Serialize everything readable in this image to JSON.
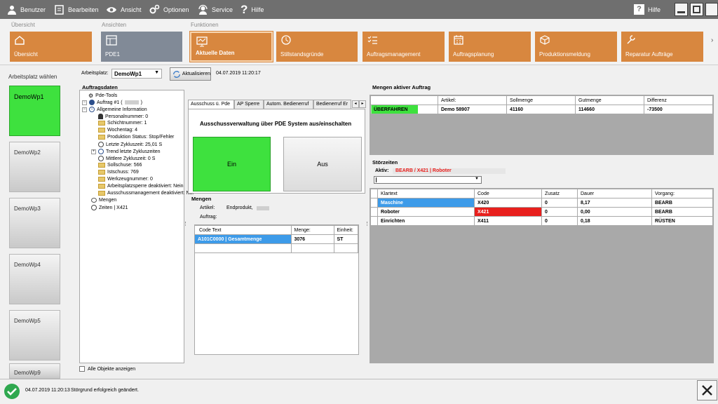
{
  "menu": {
    "items": [
      {
        "label": "Benutzer",
        "icon": "user-icon"
      },
      {
        "label": "Bearbeiten",
        "icon": "edit-icon"
      },
      {
        "label": "Ansicht",
        "icon": "eye-icon"
      },
      {
        "label": "Optionen",
        "icon": "gears-icon"
      },
      {
        "label": "Service",
        "icon": "service-icon"
      },
      {
        "label": "Hilfe",
        "icon": "question-icon"
      }
    ],
    "help_right": "Hilfe"
  },
  "ribbon": {
    "groups": [
      "Übersicht",
      "Ansichten",
      "Funktionen"
    ],
    "tiles": [
      "Übersicht",
      "PDE1",
      "Aktuelle Daten",
      "Stillstandsgründe",
      "Auftragsmanagement",
      "Auftragsplanung",
      "Produktionsmeldung",
      "Reparatur Aufträge"
    ]
  },
  "left": {
    "title": "Arbeitsplatz wählen",
    "workplaces": [
      "DemoWp1",
      "DemoWp2",
      "DemoWp3",
      "DemoWp4",
      "DemoWp5",
      "DemoWp9"
    ]
  },
  "toolbar": {
    "label": "Arbeitsplatz:",
    "value": "DemoWp1",
    "refresh": "Aktualisieren",
    "timestamp": "04.07.2019 11:20:17"
  },
  "auftrag": {
    "title": "Auftragsdaten",
    "tree": [
      "Pde-Tools",
      "Auftrag #1 (",
      "Allgemeine Information",
      "Personalnummer: 0",
      "Schichtnummer: 1",
      "Wochentag: 4",
      "Produktion Status: Stop/Fehler",
      "Letzte Zykluszeit: 25,01 S",
      "Trend letzte Zykluszeiten",
      "Mittlere Zykluszeit: 0 S",
      "Sollschuse: 566",
      "Istschuss: 769",
      "Werkzeugnummer: 0",
      "Arbeitsplatzsperre deaktiviert: Nein",
      "Ausschussmanagement deaktiviert: Nei",
      "Mengen",
      "Zeiten | X421"
    ],
    "show_all": "Alle Objekte anzeigen"
  },
  "tabs": [
    "Ausschuss ü. Pde",
    "AP Sperre",
    "Autom. Bedienerruf",
    "Bedienerruf Er"
  ],
  "ausschuss": {
    "heading": "Ausschussverwaltung über PDE System aus/einschalten",
    "on": "Ein",
    "off": "Aus"
  },
  "mengen": {
    "title": "Mengen",
    "artikel_label": "Artikel:",
    "artikel_value": "Endprodukt,",
    "auftrag_label": "Auftrag:",
    "headers": [
      "Code Text",
      "Menge:",
      "Einheit:"
    ],
    "rows": [
      [
        "A101C0000 | Gesamtmenge",
        "3076",
        "ST"
      ]
    ]
  },
  "aktiv_auftrag": {
    "title": "Mengen aktiver Auftrag",
    "headers": [
      "",
      "Artikel:",
      "Sollmenge",
      "Gutmenge",
      "Differenz"
    ],
    "row": [
      "ÜBERFAHREN",
      "Demo 58907",
      "41160",
      "114660",
      "-73500"
    ]
  },
  "stoerzeiten": {
    "title": "Störzeiten",
    "aktiv_label": "Aktiv:",
    "aktiv_value": "BEARB / X421 | Roboter",
    "headers": [
      "Klartext",
      "Code",
      "Zusatz",
      "Dauer",
      "Vorgang:"
    ],
    "rows": [
      [
        "Maschine",
        "X420",
        "0",
        "8,17",
        "BEARB"
      ],
      [
        "Roboter",
        "X421",
        "0",
        "0,00",
        "BEARB"
      ],
      [
        "Einrichten",
        "X411",
        "0",
        "0,18",
        "RÜSTEN"
      ]
    ]
  },
  "status": {
    "time": "04.07.2019 11:20:13",
    "message": "Störgrund erfolgreich geändert."
  },
  "colors": {
    "orange": "#d8873f",
    "green": "#3ee13e",
    "blue": "#3d9be9",
    "red": "#e8201d"
  }
}
